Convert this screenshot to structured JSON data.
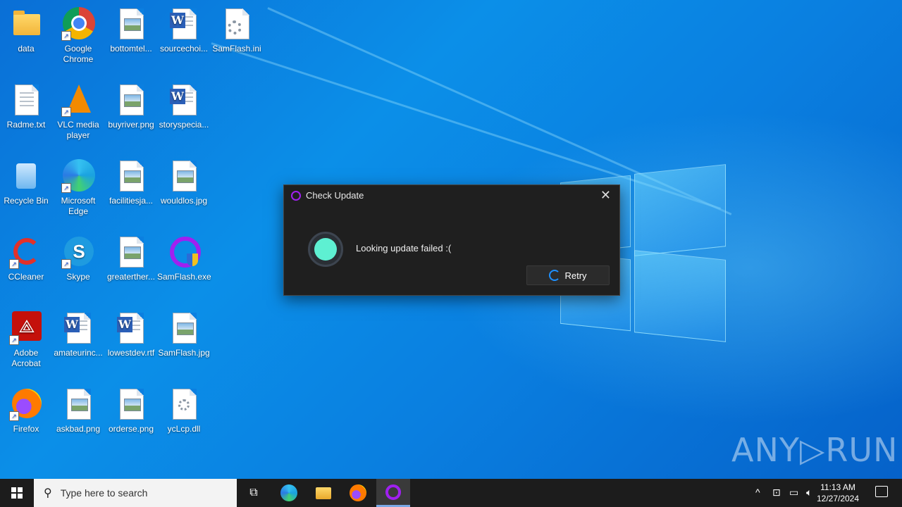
{
  "desktop": {
    "icons": [
      {
        "label": "data"
      },
      {
        "label": "Google Chrome"
      },
      {
        "label": "bottomtel..."
      },
      {
        "label": "sourcechoi..."
      },
      {
        "label": "SamFlash.ini"
      },
      {
        "label": "Radme.txt"
      },
      {
        "label": "VLC media player"
      },
      {
        "label": "buyriver.png"
      },
      {
        "label": "storyspecia..."
      },
      {
        "label": "Recycle Bin"
      },
      {
        "label": "Microsoft Edge"
      },
      {
        "label": "facilitiesja..."
      },
      {
        "label": "wouldlos.jpg"
      },
      {
        "label": "CCleaner"
      },
      {
        "label": "Skype"
      },
      {
        "label": "greaterther..."
      },
      {
        "label": "SamFlash.exe"
      },
      {
        "label": "Adobe Acrobat"
      },
      {
        "label": "amateurinc..."
      },
      {
        "label": "lowestdev.rtf"
      },
      {
        "label": "SamFlash.jpg"
      },
      {
        "label": "Firefox"
      },
      {
        "label": "askbad.png"
      },
      {
        "label": "orderse.png"
      },
      {
        "label": "ycLcp.dll"
      }
    ]
  },
  "dialog": {
    "title": "Check Update",
    "message": "Looking update failed :(",
    "retry_label": "Retry",
    "close_glyph": "✕",
    "status_color": "#5ef0d2"
  },
  "watermark": {
    "text": "ANY▷RUN"
  },
  "taskbar": {
    "search_placeholder": "Type here to search",
    "clock_time": "11:13 AM",
    "clock_date": "12/27/2024"
  },
  "colors": {
    "desktop_bg": "#0a7fe0",
    "taskbar_bg": "#1c1c1c",
    "accent": "#1e90ff",
    "app_accent": "#a020f0"
  }
}
